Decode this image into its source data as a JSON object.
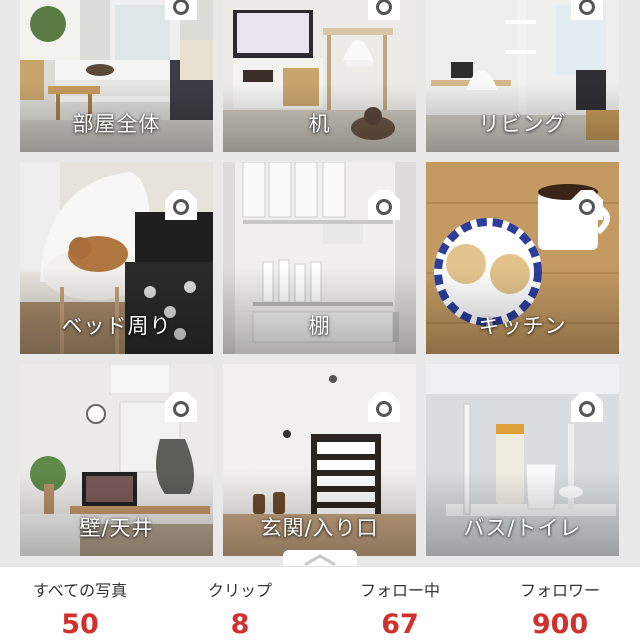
{
  "accent": "#d0312d",
  "camera_icon": "camera-icon",
  "tiles": [
    {
      "label": "部屋全体"
    },
    {
      "label": "机"
    },
    {
      "label": "リビング"
    },
    {
      "label": "ベッド周り"
    },
    {
      "label": "棚"
    },
    {
      "label": "キッチン"
    },
    {
      "label": "壁/天井"
    },
    {
      "label": "玄関/入り口"
    },
    {
      "label": "バス/トイレ"
    }
  ],
  "stats": [
    {
      "title": "すべての写真",
      "value": "50"
    },
    {
      "title": "クリップ",
      "value": "8"
    },
    {
      "title": "フォロー中",
      "value": "67"
    },
    {
      "title": "フォロワー",
      "value": "900"
    }
  ]
}
